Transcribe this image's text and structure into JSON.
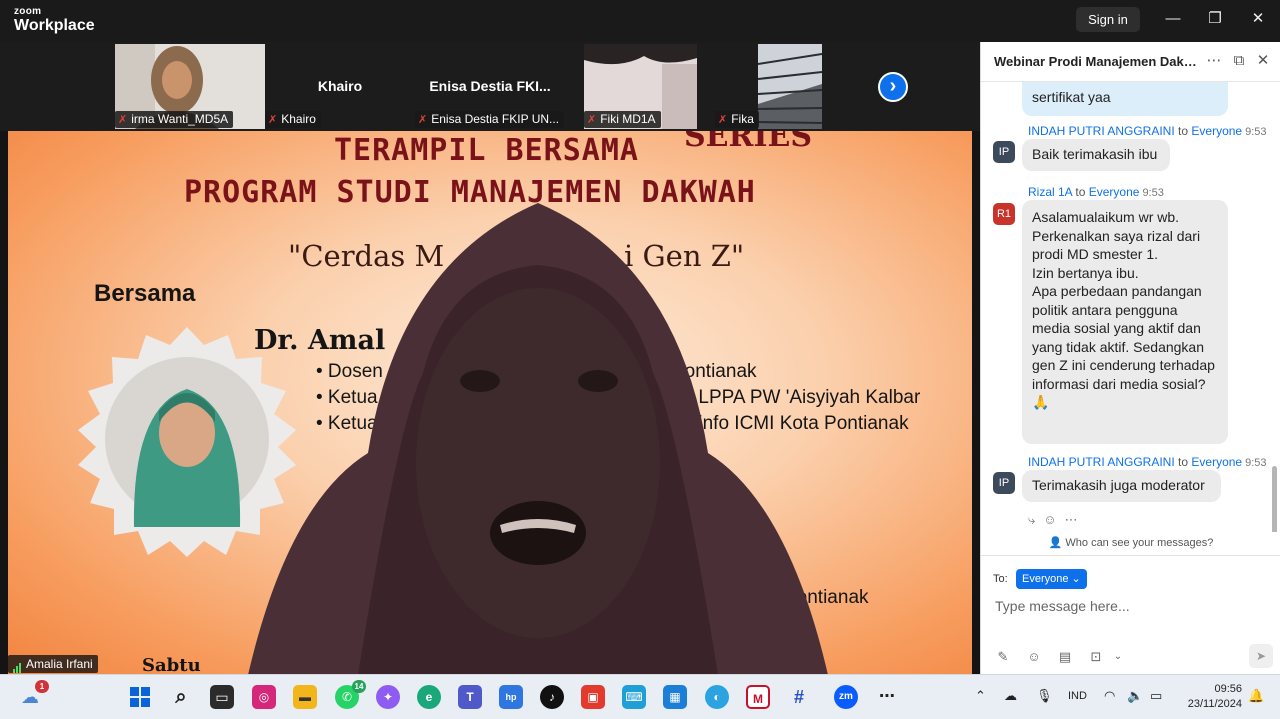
{
  "app": {
    "brand_small": "zoom",
    "brand_big": "Workplace",
    "sign_in": "Sign in"
  },
  "window": {
    "minimize": "—",
    "restore": "❐",
    "close": "✕"
  },
  "gallery": {
    "participants": [
      {
        "name": "irma Wanti_MD5A",
        "display": ""
      },
      {
        "name": "Khairo",
        "display": "Khairo"
      },
      {
        "name": "Enisa Destia FKIP UN...",
        "display": "Enisa Destia FKI..."
      },
      {
        "name": "Fiki MD1A",
        "display": ""
      },
      {
        "name": "Fika",
        "display": ""
      }
    ],
    "next": "›"
  },
  "stage": {
    "speaker_name": "Amalia Irfani",
    "slide": {
      "series": "SERIES",
      "title_line1": "TERAMPIL BERSAMA",
      "title_line2": "PROGRAM STUDI MANAJEMEN DAKWAH",
      "subtitle_left": "\"Cerdas M",
      "subtitle_right": "i Gen Z\"",
      "bersama": "Bersama",
      "speaker_partial": "Dr. Amal",
      "bullets": [
        {
          "left": "• Dosen",
          "right": "Pontianak"
        },
        {
          "left": "• Ketua",
          "right": "an LPPA PW 'Aisyiyah Kalbar"
        },
        {
          "left": "• Ketua",
          "right": "ominfo ICMI Kota Pontianak"
        }
      ],
      "extra_right": "Pontianak",
      "day": "Sabtu"
    }
  },
  "chat": {
    "title": "Webinar Prodi Manajemen Dakw...",
    "messages": [
      {
        "text": "sertifikat yaa"
      },
      {
        "sender": "INDAH PUTRI ANGGRAINI",
        "to": "to",
        "recipient": "Everyone",
        "time": "9:53",
        "avatar": "IP",
        "avatar_color": "#3d4a5c",
        "text": "Baik terimakasih ibu"
      },
      {
        "sender": "Rizal 1A",
        "to": "to",
        "recipient": "Everyone",
        "time": "9:53",
        "avatar": "R1",
        "avatar_color": "#c8332b",
        "lines": [
          "Asalamualaikum wr wb.",
          "Perkenalkan saya rizal dari",
          "prodi MD smester 1.",
          "Izin bertanya ibu.",
          "Apa perbedaan pandangan",
          "politik antara pengguna",
          "media sosial yang aktif dan",
          "yang tidak aktif. Sedangkan",
          "gen Z ini cenderung terhadap",
          "informasi dari media sosial?",
          "🙏"
        ]
      },
      {
        "sender": "INDAH PUTRI ANGGRAINI",
        "to": "to",
        "recipient": "Everyone",
        "time": "9:53",
        "avatar": "IP",
        "avatar_color": "#3d4a5c",
        "text": "Terimakasih juga moderator"
      }
    ],
    "who_can_see": "Who can see your messages?",
    "to_label": "To:",
    "to_value": "Everyone ⌄",
    "input_placeholder": "Type message here..."
  },
  "taskbar": {
    "weather_badge": "1",
    "whatsapp_badge": "14",
    "language": "IND",
    "time": "09:56",
    "date": "23/11/2024"
  }
}
